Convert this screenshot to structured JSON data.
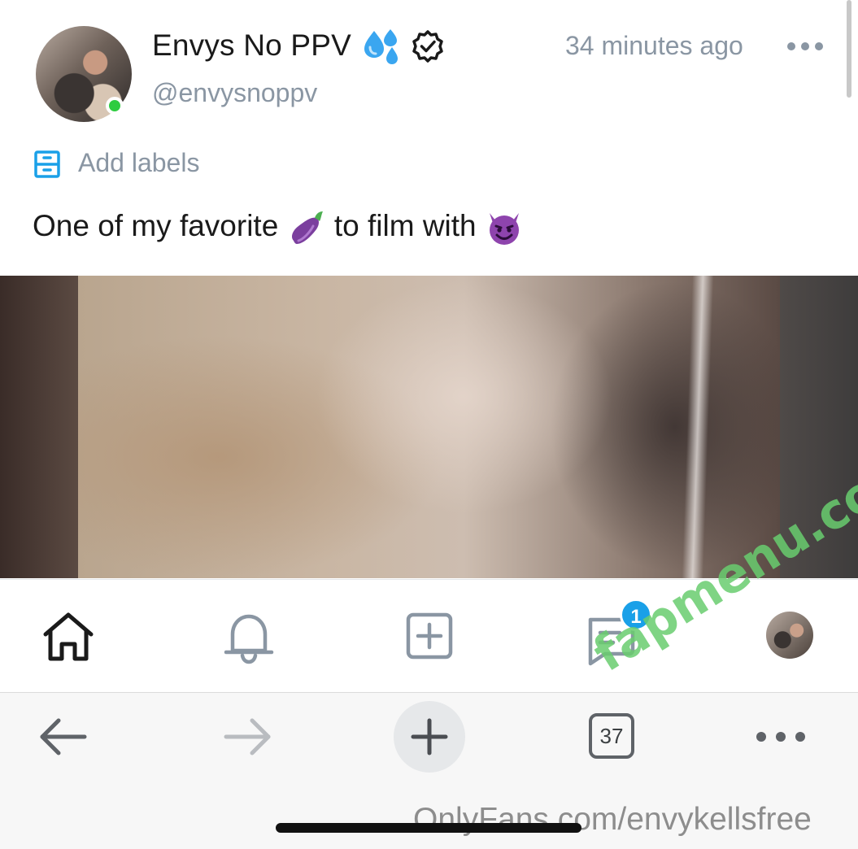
{
  "post": {
    "display_name": "Envys No PPV",
    "username": "@envysnoppv",
    "timestamp": "34 minutes ago",
    "add_labels": "Add labels",
    "caption": "One of my favorite",
    "caption_middle": "to film with",
    "name_emoji": "droplets-emoji",
    "caption_emojis": [
      "eggplant-emoji",
      "smiling-devil-emoji"
    ]
  },
  "nav": {
    "icons": [
      "home-icon",
      "bell-icon",
      "add-post-icon",
      "messages-icon",
      "profile-avatar"
    ],
    "messages_badge": "1"
  },
  "browser": {
    "tab_count": "37",
    "url": "OnlyFans.com/envykellsfree"
  },
  "watermark": "fapmenu.com",
  "colors": {
    "accent": "#1aa0e8",
    "muted": "#8a96a3",
    "online": "#2ecc40",
    "watermark": "#69cd6e"
  }
}
